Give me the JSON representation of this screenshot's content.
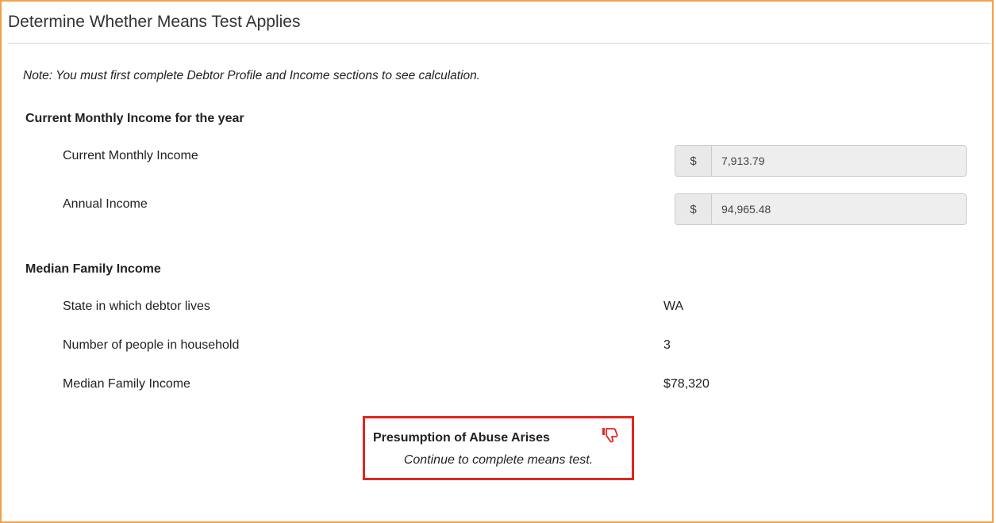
{
  "panel": {
    "title": "Determine Whether Means Test Applies",
    "note": "Note: You must first complete Debtor Profile and Income sections to see calculation."
  },
  "current_monthly_income": {
    "heading": "Current Monthly Income for the year",
    "rows": [
      {
        "label": "Current Monthly Income",
        "currency": "$",
        "value": "7,913.79"
      },
      {
        "label": "Annual Income",
        "currency": "$",
        "value": "94,965.48"
      }
    ]
  },
  "median_family_income": {
    "heading": "Median Family Income",
    "rows": [
      {
        "label": "State in which debtor lives",
        "value": "WA"
      },
      {
        "label": "Number of people in household",
        "value": "3"
      },
      {
        "label": "Median Family Income",
        "value": "$78,320"
      }
    ]
  },
  "result": {
    "title": "Presumption of Abuse Arises",
    "subtitle": "Continue to complete means test.",
    "icon": "thumbs-down-icon",
    "accent_color": "#e3261f"
  },
  "colors": {
    "panel_border": "#f0a24a",
    "result_border": "#e3261f"
  }
}
